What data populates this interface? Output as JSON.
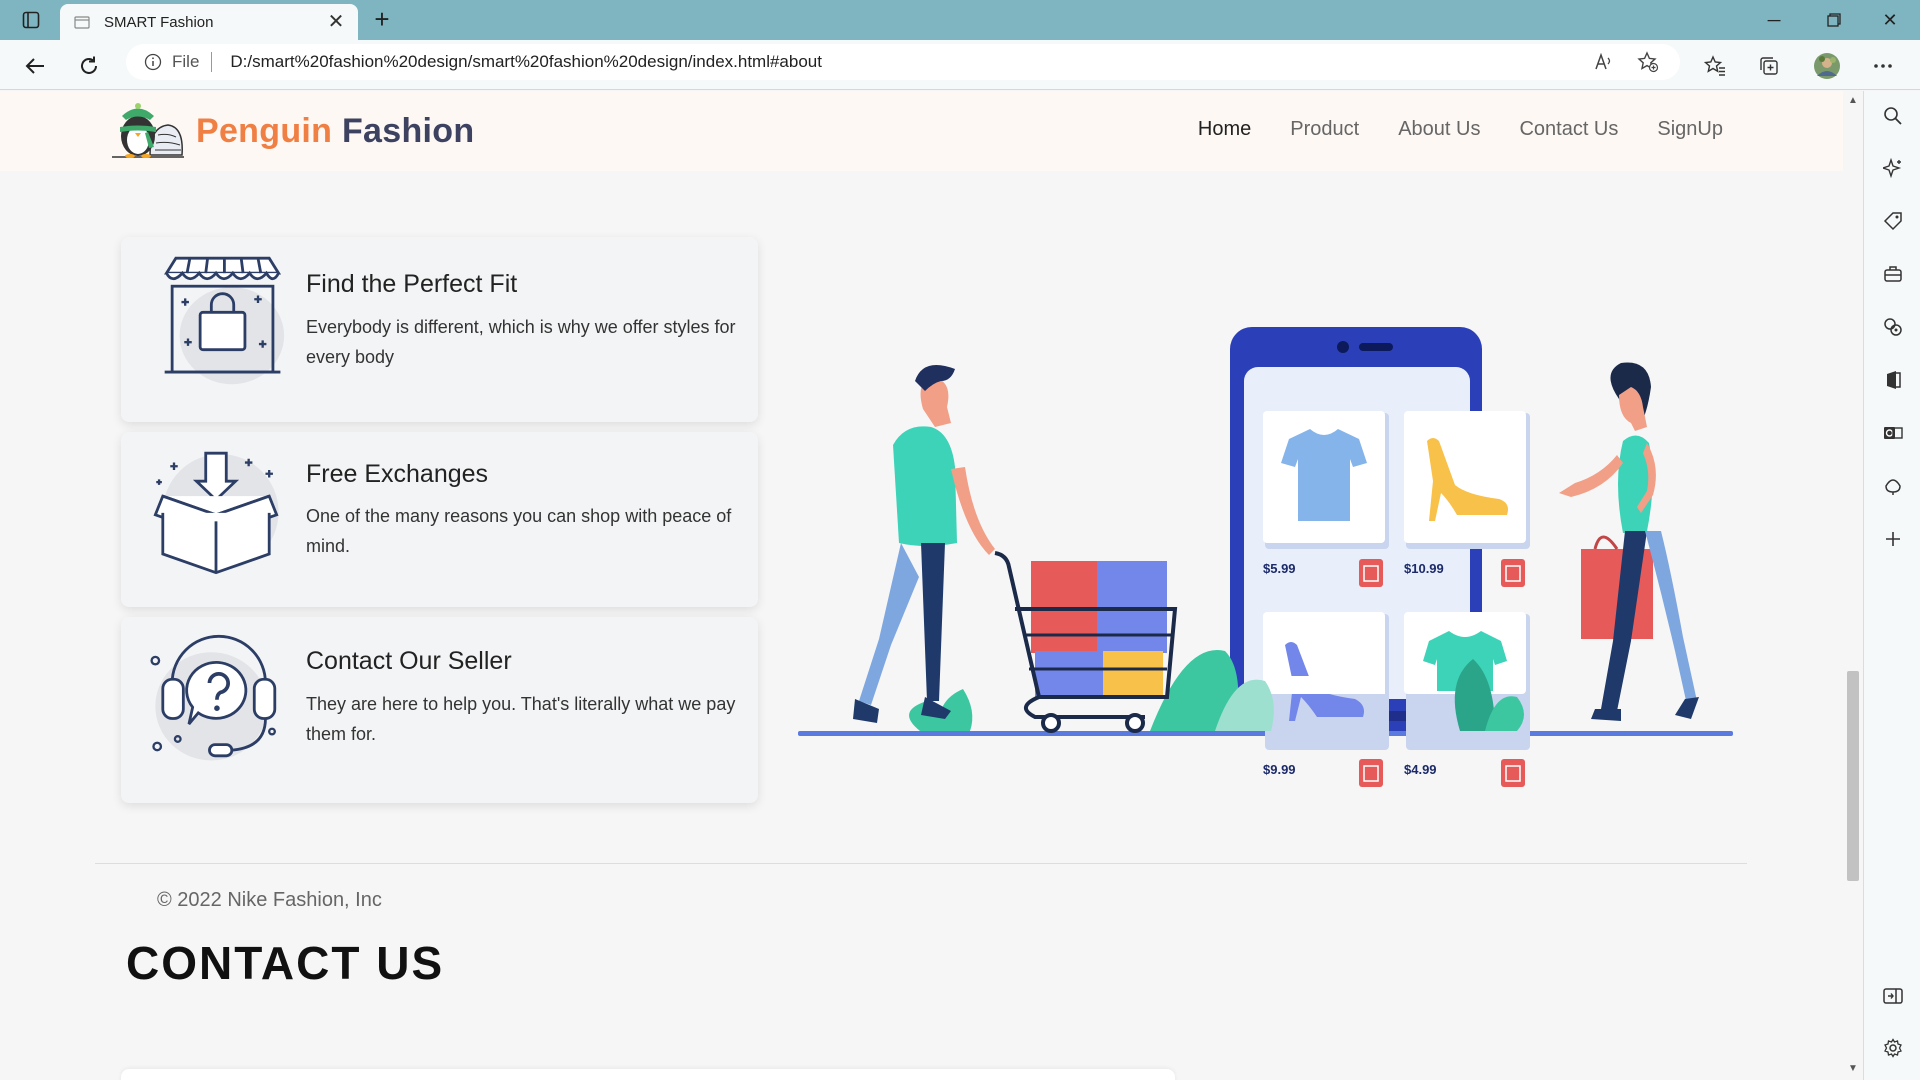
{
  "browser": {
    "tab_title": "SMART Fashion",
    "address_scheme": "File",
    "address_url": "D:/smart%20fashion%20design/smart%20fashion%20design/index.html#about"
  },
  "site": {
    "logo_part1": "Penguin",
    "logo_part2": "Fashion",
    "nav": [
      {
        "label": "Home"
      },
      {
        "label": "Product"
      },
      {
        "label": "About Us"
      },
      {
        "label": "Contact Us"
      },
      {
        "label": "SignUp"
      }
    ]
  },
  "features": [
    {
      "title": "Find the Perfect Fit",
      "text": "Everybody is different, which is why we offer styles for every body",
      "icon": "shop-icon"
    },
    {
      "title": "Free Exchanges",
      "text": "One of the many reasons you can shop with peace of mind.",
      "icon": "box-icon"
    },
    {
      "title": "Contact Our Seller",
      "text": "They are here to help you. That's literally what we pay them for.",
      "icon": "support-icon"
    }
  ],
  "illustration": {
    "prices": [
      "$5.99",
      "$10.99",
      "$9.99",
      "$4.99"
    ]
  },
  "footer": {
    "copyright": "© 2022 Nike Fashion, Inc"
  },
  "contact": {
    "heading": "CONTACT US"
  },
  "colors": {
    "accent": "#f07f44",
    "brand_dark": "#3d4261",
    "phone": "#2b3fb8",
    "teal": "#3dd3b8"
  }
}
